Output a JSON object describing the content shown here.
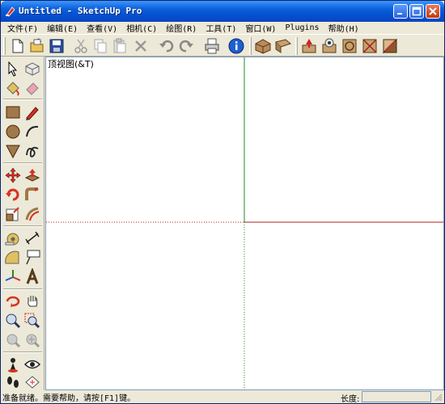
{
  "window": {
    "title": "Untitled - SketchUp Pro"
  },
  "menu": [
    {
      "label": "文件(F)"
    },
    {
      "label": "编辑(E)"
    },
    {
      "label": "查看(V)"
    },
    {
      "label": "相机(C)"
    },
    {
      "label": "绘图(R)"
    },
    {
      "label": "工具(T)"
    },
    {
      "label": "窗口(W)"
    },
    {
      "label": "Plugins"
    },
    {
      "label": "帮助(H)"
    }
  ],
  "toolbar": {
    "buttons": [
      "new-icon",
      "open-icon",
      "save-icon",
      "cut-icon",
      "copy-icon",
      "paste-icon",
      "erase-icon",
      "undo-icon",
      "redo-icon",
      "print-icon",
      "model-info-icon",
      "face-style-icon",
      "section-icon",
      "add-location-icon",
      "preview-icon",
      "component-icon",
      "sandbox-icon"
    ]
  },
  "viewport": {
    "label": "顶视图(&T)"
  },
  "colors": {
    "xaxis": "#b22222",
    "yaxis": "#228b22",
    "accent": "#0a5fd8"
  },
  "status": {
    "message": "准备就绪。需要帮助，请按[F1]键。",
    "length_label": "长度:",
    "length_value": ""
  }
}
